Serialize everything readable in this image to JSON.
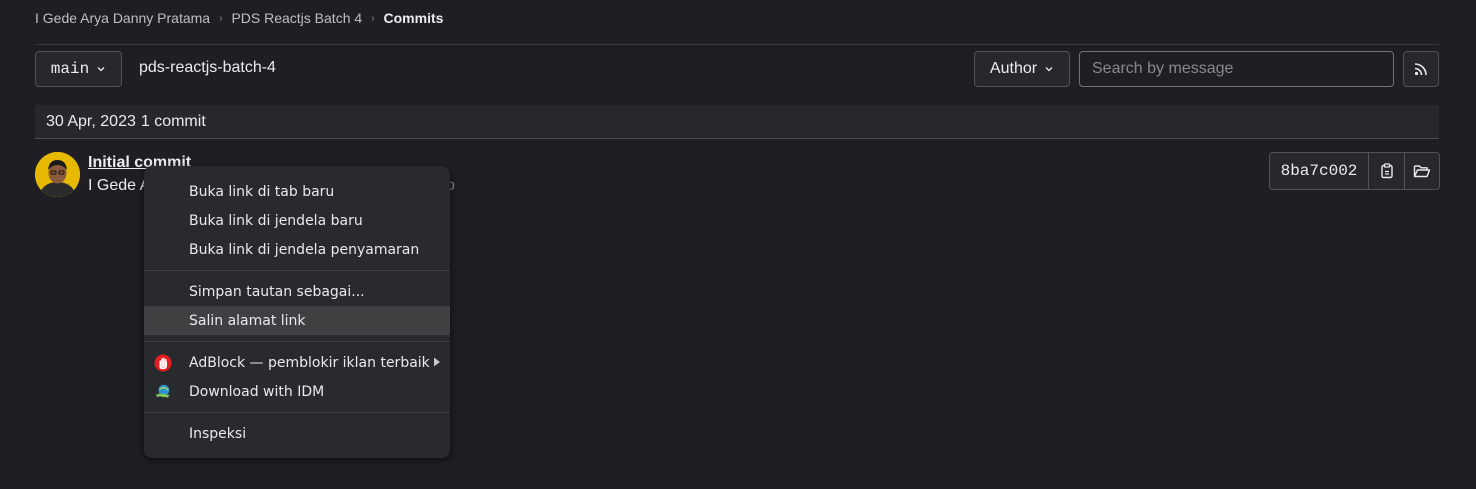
{
  "breadcrumb": {
    "items": [
      "I Gede Arya Danny Pratama",
      "PDS Reactjs Batch 4"
    ],
    "current": "Commits",
    "separator": "›"
  },
  "toolbar": {
    "branch": "main",
    "repo_name": "pds-reactjs-batch-4",
    "author_label": "Author",
    "search_placeholder": "Search by message"
  },
  "commit_group": {
    "date": "30 Apr, 2023",
    "count": "1 commit"
  },
  "commit": {
    "title": "Initial commit",
    "author_visible": "I Gede A",
    "time_fragment": "o",
    "sha": "8ba7c002"
  },
  "context_menu": {
    "groups": [
      [
        "Buka link di tab baru",
        "Buka link di jendela baru",
        "Buka link di jendela penyamaran"
      ],
      [
        "Simpan tautan sebagai...",
        "Salin alamat link"
      ],
      [
        "AdBlock — pemblokir iklan terbaik",
        "Download with IDM"
      ],
      [
        "Inspeksi"
      ]
    ],
    "highlighted": "Salin alamat link"
  },
  "colors": {
    "background": "#1f1e24",
    "surface": "#28272d",
    "border": "#535158",
    "menu_background": "#292a2d",
    "menu_highlight": "#3f4042",
    "adblock_red": "#e02020",
    "avatar_yellow": "#e6b800"
  },
  "icons": {
    "branch_dropdown": "chevron-down-icon",
    "rss": "rss-icon",
    "copy_sha": "clipboard-icon",
    "browse_files": "folder-open-icon",
    "adblock": "adblock-hand-icon",
    "idm": "idm-globe-icon",
    "submenu": "chevron-right-icon"
  }
}
